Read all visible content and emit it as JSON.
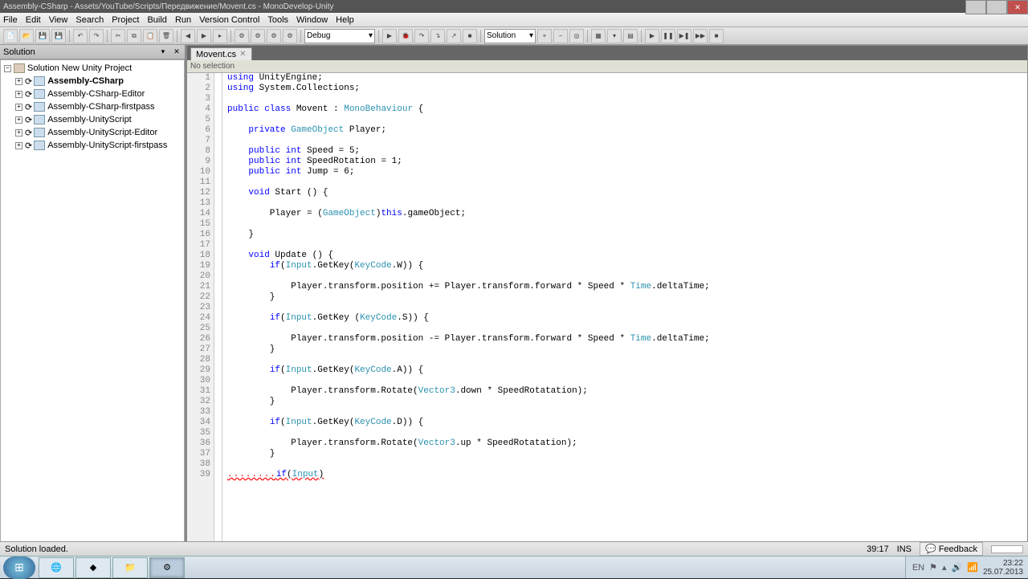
{
  "title_bar": "Assembly-CSharp - Assets/YouTube/Scripts/Передвижение/Movent.cs - MonoDevelop-Unity",
  "menu": [
    "File",
    "Edit",
    "View",
    "Search",
    "Project",
    "Build",
    "Run",
    "Version Control",
    "Tools",
    "Window",
    "Help"
  ],
  "toolbar": {
    "config": "Debug",
    "solution_combo": "Solution"
  },
  "solution": {
    "panel_title": "Solution",
    "root": "Solution New Unity Project",
    "items": [
      {
        "label": "Assembly-CSharp",
        "bold": true
      },
      {
        "label": "Assembly-CSharp-Editor"
      },
      {
        "label": "Assembly-CSharp-firstpass"
      },
      {
        "label": "Assembly-UnityScript"
      },
      {
        "label": "Assembly-UnityScript-Editor"
      },
      {
        "label": "Assembly-UnityScript-firstpass"
      }
    ]
  },
  "editor": {
    "tab_label": "Movent.cs",
    "no_selection": "No selection",
    "lines": [
      {
        "n": 1,
        "t": "using",
        "rest": " UnityEngine;",
        "indent": ""
      },
      {
        "n": 2,
        "t": "using",
        "rest": " System.Collections;",
        "indent": ""
      },
      {
        "n": 3,
        "raw": " "
      },
      {
        "n": 4,
        "indent": "",
        "parts": [
          {
            "c": "kw",
            "t": "public class"
          },
          {
            "t": " Movent : "
          },
          {
            "c": "type",
            "t": "MonoBehaviour"
          },
          {
            "t": " {"
          }
        ]
      },
      {
        "n": 5,
        "raw": " "
      },
      {
        "n": 6,
        "indent": "    ",
        "parts": [
          {
            "c": "kw",
            "t": "private"
          },
          {
            "t": " "
          },
          {
            "c": "type",
            "t": "GameObject"
          },
          {
            "t": " Player;"
          }
        ]
      },
      {
        "n": 7,
        "raw": " "
      },
      {
        "n": 8,
        "indent": "    ",
        "parts": [
          {
            "c": "kw",
            "t": "public int"
          },
          {
            "t": " Speed = 5;"
          }
        ]
      },
      {
        "n": 9,
        "indent": "    ",
        "parts": [
          {
            "c": "kw",
            "t": "public int"
          },
          {
            "t": " SpeedRotation = 1;"
          }
        ]
      },
      {
        "n": 10,
        "indent": "    ",
        "parts": [
          {
            "c": "kw",
            "t": "public int"
          },
          {
            "t": " Jump = 6;"
          }
        ]
      },
      {
        "n": 11,
        "raw": " "
      },
      {
        "n": 12,
        "indent": "    ",
        "parts": [
          {
            "c": "kw",
            "t": "void"
          },
          {
            "t": " Start () {"
          }
        ]
      },
      {
        "n": 13,
        "raw": " "
      },
      {
        "n": 14,
        "indent": "        ",
        "parts": [
          {
            "t": "Player = ("
          },
          {
            "c": "type",
            "t": "GameObject"
          },
          {
            "t": ")"
          },
          {
            "c": "kw",
            "t": "this"
          },
          {
            "t": ".gameObject;"
          }
        ]
      },
      {
        "n": 15,
        "raw": " "
      },
      {
        "n": 16,
        "indent": "    ",
        "parts": [
          {
            "t": "}"
          }
        ]
      },
      {
        "n": 17,
        "raw": " "
      },
      {
        "n": 18,
        "indent": "    ",
        "parts": [
          {
            "c": "kw",
            "t": "void"
          },
          {
            "t": " Update () {"
          }
        ]
      },
      {
        "n": 19,
        "indent": "        ",
        "parts": [
          {
            "c": "kw",
            "t": "if"
          },
          {
            "t": "("
          },
          {
            "c": "type",
            "t": "Input"
          },
          {
            "t": ".GetKey("
          },
          {
            "c": "type",
            "t": "KeyCode"
          },
          {
            "t": ".W)) {"
          }
        ]
      },
      {
        "n": 20,
        "raw": " "
      },
      {
        "n": 21,
        "indent": "            ",
        "parts": [
          {
            "t": "Player.transform.position += Player.transform.forward * Speed * "
          },
          {
            "c": "type",
            "t": "Time"
          },
          {
            "t": ".deltaTime;"
          }
        ]
      },
      {
        "n": 22,
        "indent": "        ",
        "parts": [
          {
            "t": "}"
          }
        ]
      },
      {
        "n": 23,
        "raw": " "
      },
      {
        "n": 24,
        "indent": "        ",
        "parts": [
          {
            "c": "kw",
            "t": "if"
          },
          {
            "t": "("
          },
          {
            "c": "type",
            "t": "Input"
          },
          {
            "t": ".GetKey ("
          },
          {
            "c": "type",
            "t": "KeyCode"
          },
          {
            "t": ".S)) {"
          }
        ]
      },
      {
        "n": 25,
        "raw": " "
      },
      {
        "n": 26,
        "indent": "            ",
        "parts": [
          {
            "t": "Player.transform.position -= Player.transform.forward * Speed * "
          },
          {
            "c": "type",
            "t": "Time"
          },
          {
            "t": ".deltaTime;"
          }
        ]
      },
      {
        "n": 27,
        "indent": "        ",
        "parts": [
          {
            "t": "}"
          }
        ]
      },
      {
        "n": 28,
        "raw": " "
      },
      {
        "n": 29,
        "indent": "        ",
        "parts": [
          {
            "c": "kw",
            "t": "if"
          },
          {
            "t": "("
          },
          {
            "c": "type",
            "t": "Input"
          },
          {
            "t": ".GetKey("
          },
          {
            "c": "type",
            "t": "KeyCode"
          },
          {
            "t": ".A)) {"
          }
        ]
      },
      {
        "n": 30,
        "raw": " "
      },
      {
        "n": 31,
        "indent": "            ",
        "parts": [
          {
            "t": "Player.transform.Rotate("
          },
          {
            "c": "type",
            "t": "Vector3"
          },
          {
            "t": ".down * SpeedRotatation);"
          }
        ]
      },
      {
        "n": 32,
        "indent": "        ",
        "parts": [
          {
            "t": "}"
          }
        ]
      },
      {
        "n": 33,
        "raw": " "
      },
      {
        "n": 34,
        "indent": "        ",
        "parts": [
          {
            "c": "kw",
            "t": "if"
          },
          {
            "t": "("
          },
          {
            "c": "type",
            "t": "Input"
          },
          {
            "t": ".GetKey("
          },
          {
            "c": "type",
            "t": "KeyCode"
          },
          {
            "t": ".D)) {"
          }
        ]
      },
      {
        "n": 35,
        "raw": " "
      },
      {
        "n": 36,
        "indent": "            ",
        "parts": [
          {
            "t": "Player.transform.Rotate("
          },
          {
            "c": "type",
            "t": "Vector3"
          },
          {
            "t": ".up * SpeedRotatation);"
          }
        ]
      },
      {
        "n": 37,
        "indent": "        ",
        "parts": [
          {
            "t": "}"
          }
        ]
      },
      {
        "n": 38,
        "raw": " "
      },
      {
        "n": 39,
        "indent": "        ",
        "err": true,
        "err_pre": "........",
        "parts": [
          {
            "c": "kw",
            "t": "if"
          },
          {
            "t": "("
          },
          {
            "c": "type",
            "t": "Input"
          },
          {
            "t": ")"
          }
        ]
      }
    ]
  },
  "status": {
    "left": "Solution loaded.",
    "caret": "39:17",
    "mode": "INS",
    "feedback": "Feedback"
  },
  "taskbar": {
    "lang": "EN",
    "time": "23:22",
    "date": "25.07.2013"
  }
}
